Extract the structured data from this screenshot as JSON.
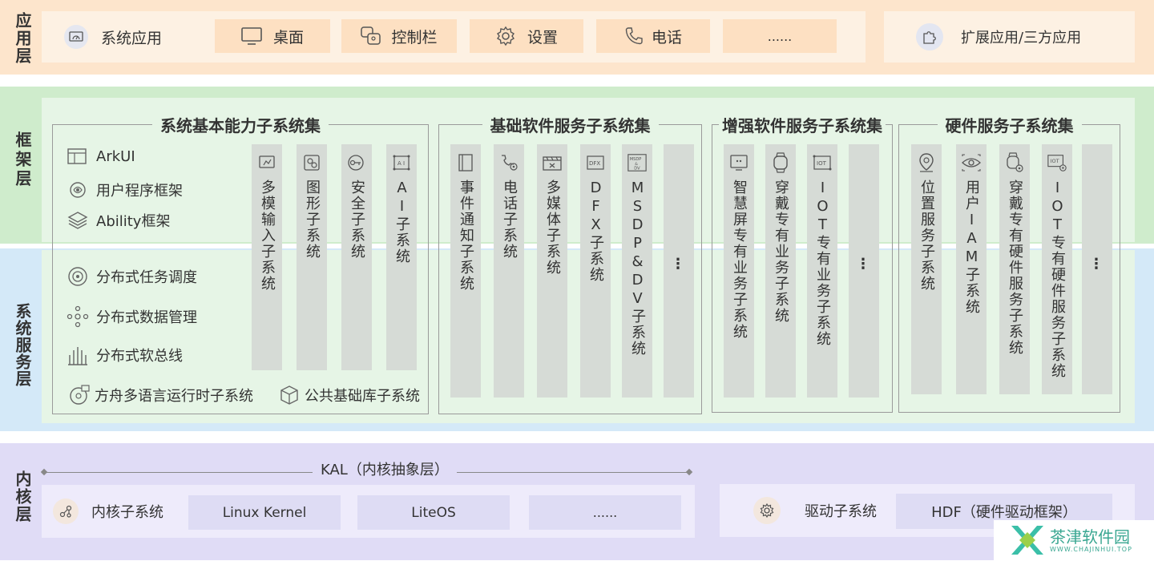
{
  "app_layer": {
    "label": "应用层",
    "items": [
      {
        "label": "系统应用",
        "icon": "gauge-icon"
      },
      {
        "label": "桌面",
        "icon": "monitor-icon"
      },
      {
        "label": "控制栏",
        "icon": "control-panel-icon"
      },
      {
        "label": "设置",
        "icon": "gear-icon"
      },
      {
        "label": "电话",
        "icon": "phone-icon"
      },
      {
        "label": "......",
        "icon": ""
      }
    ],
    "extension": {
      "label": "扩展应用/三方应用",
      "icon": "puzzle-icon"
    }
  },
  "framework_label": "框架层",
  "service_label": "系统服务层",
  "groups": {
    "basic": {
      "title": "系统基本能力子系统集",
      "left_items": [
        {
          "label": "ArkUI",
          "icon": "layout-icon"
        },
        {
          "label": "用户程序框架",
          "icon": "brain-icon"
        },
        {
          "label": "Ability框架",
          "icon": "layers-icon"
        },
        {
          "label": "分布式任务调度",
          "icon": "schedule-icon"
        },
        {
          "label": "分布式数据管理",
          "icon": "network-icon"
        },
        {
          "label": "分布式软总线",
          "icon": "bus-icon"
        },
        {
          "label": "方舟多语言运行时子系统",
          "icon": "runtime-icon"
        },
        {
          "label": "公共基础库子系统",
          "icon": "cube-icon"
        }
      ],
      "columns": [
        {
          "label": "多模输入子系统",
          "icon": "input-icon"
        },
        {
          "label": "图形子系统",
          "icon": "graphics-icon"
        },
        {
          "label": "安全子系统",
          "icon": "key-icon"
        },
        {
          "label": "AI子系统",
          "icon": "ai-icon"
        }
      ]
    },
    "software": {
      "title": "基础软件服务子系统集",
      "columns": [
        {
          "label": "事件通知子系统",
          "icon": "notification-icon"
        },
        {
          "label": "电话子系统",
          "icon": "phone-gear-icon"
        },
        {
          "label": "多媒体子系统",
          "icon": "media-icon"
        },
        {
          "label": "DFX子系统",
          "icon": "dfx-icon"
        },
        {
          "label": "MSDP&DV子系统",
          "icon": "msdp-icon"
        },
        {
          "label": "⋮",
          "icon": ""
        }
      ]
    },
    "enhanced": {
      "title": "增强软件服务子系统集",
      "columns": [
        {
          "label": "智慧屏专有业务子系统",
          "icon": "screen-icon"
        },
        {
          "label": "穿戴专有业务子系统",
          "icon": "watch-icon"
        },
        {
          "label": "IOT专有业务子系统",
          "icon": "iot-icon"
        },
        {
          "label": "⋮",
          "icon": ""
        }
      ]
    },
    "hardware": {
      "title": "硬件服务子系统集",
      "columns": [
        {
          "label": "位置服务子系统",
          "icon": "location-icon"
        },
        {
          "label": "用户IAM子系统",
          "icon": "eye-icon"
        },
        {
          "label": "穿戴专有硬件服务子系统",
          "icon": "watch-gear-icon"
        },
        {
          "label": "IOT专有硬件服务子系统",
          "icon": "iot-gear-icon"
        },
        {
          "label": "⋮",
          "icon": ""
        }
      ]
    }
  },
  "kernel_layer": {
    "label": "内核层",
    "kal": "KAL（内核抽象层）",
    "kernel_subsystem": {
      "label": "内核子系统",
      "icon": "kernel-icon"
    },
    "kernels": [
      "Linux Kernel",
      "LiteOS",
      "......"
    ],
    "driver_subsystem": {
      "label": "驱动子系统",
      "icon": "driver-icon"
    },
    "hdf": "HDF（硬件驱动框架）"
  },
  "watermark": {
    "main": "茶津软件园",
    "sub": "WWW.CHAJINHUI.TOP"
  },
  "colors": {
    "app_band": "#fde5cc",
    "framework_band": "#cfeccc",
    "service_band": "#d4e9f8",
    "kernel_band": "#e0dcf6",
    "inner_light": "#fdf1e3"
  }
}
